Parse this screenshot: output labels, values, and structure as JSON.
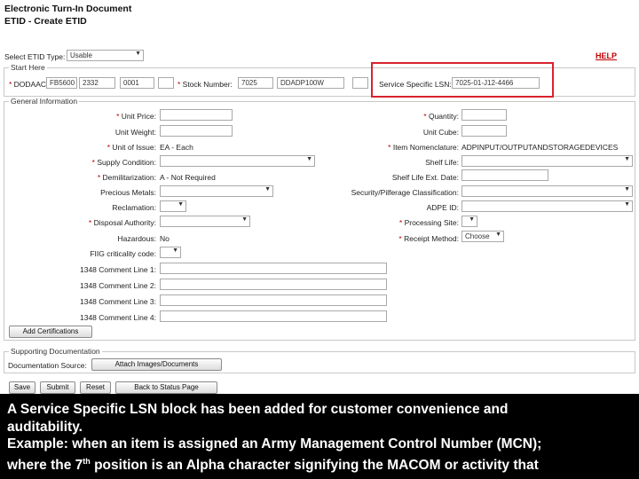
{
  "page": {
    "title": "Electronic Turn-In Document",
    "subtitle": "ETID - Create ETID",
    "help": "HELP"
  },
  "etid_type": {
    "label": "Select ETID Type:",
    "value": "Usable"
  },
  "start_here": {
    "legend": "Start Here",
    "dodaac_label": "DODAAC:",
    "dodaac_value": "FB5600",
    "seq1_value": "2332",
    "seq2_value": "0001",
    "stock_label": "Stock Number:",
    "stock_value": "7025",
    "stock2_value": "DDADP100W",
    "lsn_label": "Service Specific LSN:",
    "lsn_value": "7025-01-J12-4466"
  },
  "general": {
    "legend": "General Information",
    "left": [
      {
        "label": "Unit Price:",
        "required": "*",
        "kind": "input",
        "value": ""
      },
      {
        "label": "Unit Weight:",
        "required": "",
        "kind": "input",
        "value": ""
      },
      {
        "label": "Unit of Issue:",
        "required": "*",
        "kind": "text",
        "value": "EA - Each"
      },
      {
        "label": "Supply Condition:",
        "required": "*",
        "kind": "select",
        "value": ""
      },
      {
        "label": "Demilitarization:",
        "required": "*",
        "kind": "text",
        "value": "A - Not Required"
      },
      {
        "label": "Precious Metals:",
        "required": "",
        "kind": "select",
        "value": ""
      },
      {
        "label": "Reclamation:",
        "required": "",
        "kind": "select",
        "value": ""
      },
      {
        "label": "Disposal Authority:",
        "required": "*",
        "kind": "select",
        "value": ""
      },
      {
        "label": "Hazardous:",
        "required": "",
        "kind": "text",
        "value": "No"
      },
      {
        "label": "FIIG criticality code:",
        "required": "",
        "kind": "select",
        "value": ""
      },
      {
        "label": "1348 Comment Line 1:",
        "required": "",
        "kind": "input",
        "value": ""
      },
      {
        "label": "1348 Comment Line 2:",
        "required": "",
        "kind": "input",
        "value": ""
      },
      {
        "label": "1348 Comment Line 3:",
        "required": "",
        "kind": "input",
        "value": ""
      },
      {
        "label": "1348 Comment Line 4:",
        "required": "",
        "kind": "input",
        "value": ""
      }
    ],
    "right": [
      {
        "label": "Quantity:",
        "required": "*",
        "kind": "input",
        "value": ""
      },
      {
        "label": "Unit Cube:",
        "required": "",
        "kind": "input",
        "value": ""
      },
      {
        "label": "Item Nomenclature:",
        "required": "*",
        "kind": "text",
        "value": "ADPINPUT/OUTPUTANDSTORAGEDEVICES"
      },
      {
        "label": "Shelf Life:",
        "required": "",
        "kind": "select",
        "value": ""
      },
      {
        "label": "Shelf Life Ext. Date:",
        "required": "",
        "kind": "input",
        "value": ""
      },
      {
        "label": "Security/Pilferage Classification:",
        "required": "",
        "kind": "select",
        "value": ""
      },
      {
        "label": "ADPE ID:",
        "required": "",
        "kind": "select",
        "value": ""
      },
      {
        "label": "Processing Site:",
        "required": "*",
        "kind": "select",
        "value": ""
      },
      {
        "label": "Receipt Method:",
        "required": "*",
        "kind": "select",
        "value": "Choose"
      }
    ],
    "add_cert": "Add Certifications"
  },
  "docs": {
    "legend": "Supporting Documentation",
    "label": "Documentation Source:",
    "attach": "Attach Images/Documents"
  },
  "actions": {
    "save": "Save",
    "submit": "Submit",
    "reset": "Reset",
    "back": "Back to Status Page"
  },
  "caption": {
    "line1": "A Service Specific LSN block has been added for customer convenience and",
    "line2": "auditability.",
    "line3": "Example: when an item is assigned an Army Management Control Number (MCN);",
    "line4_a": "where the 7",
    "line4_sup": "th",
    "line4_b": " position is an Alpha character signifying the MACOM or activity that"
  }
}
